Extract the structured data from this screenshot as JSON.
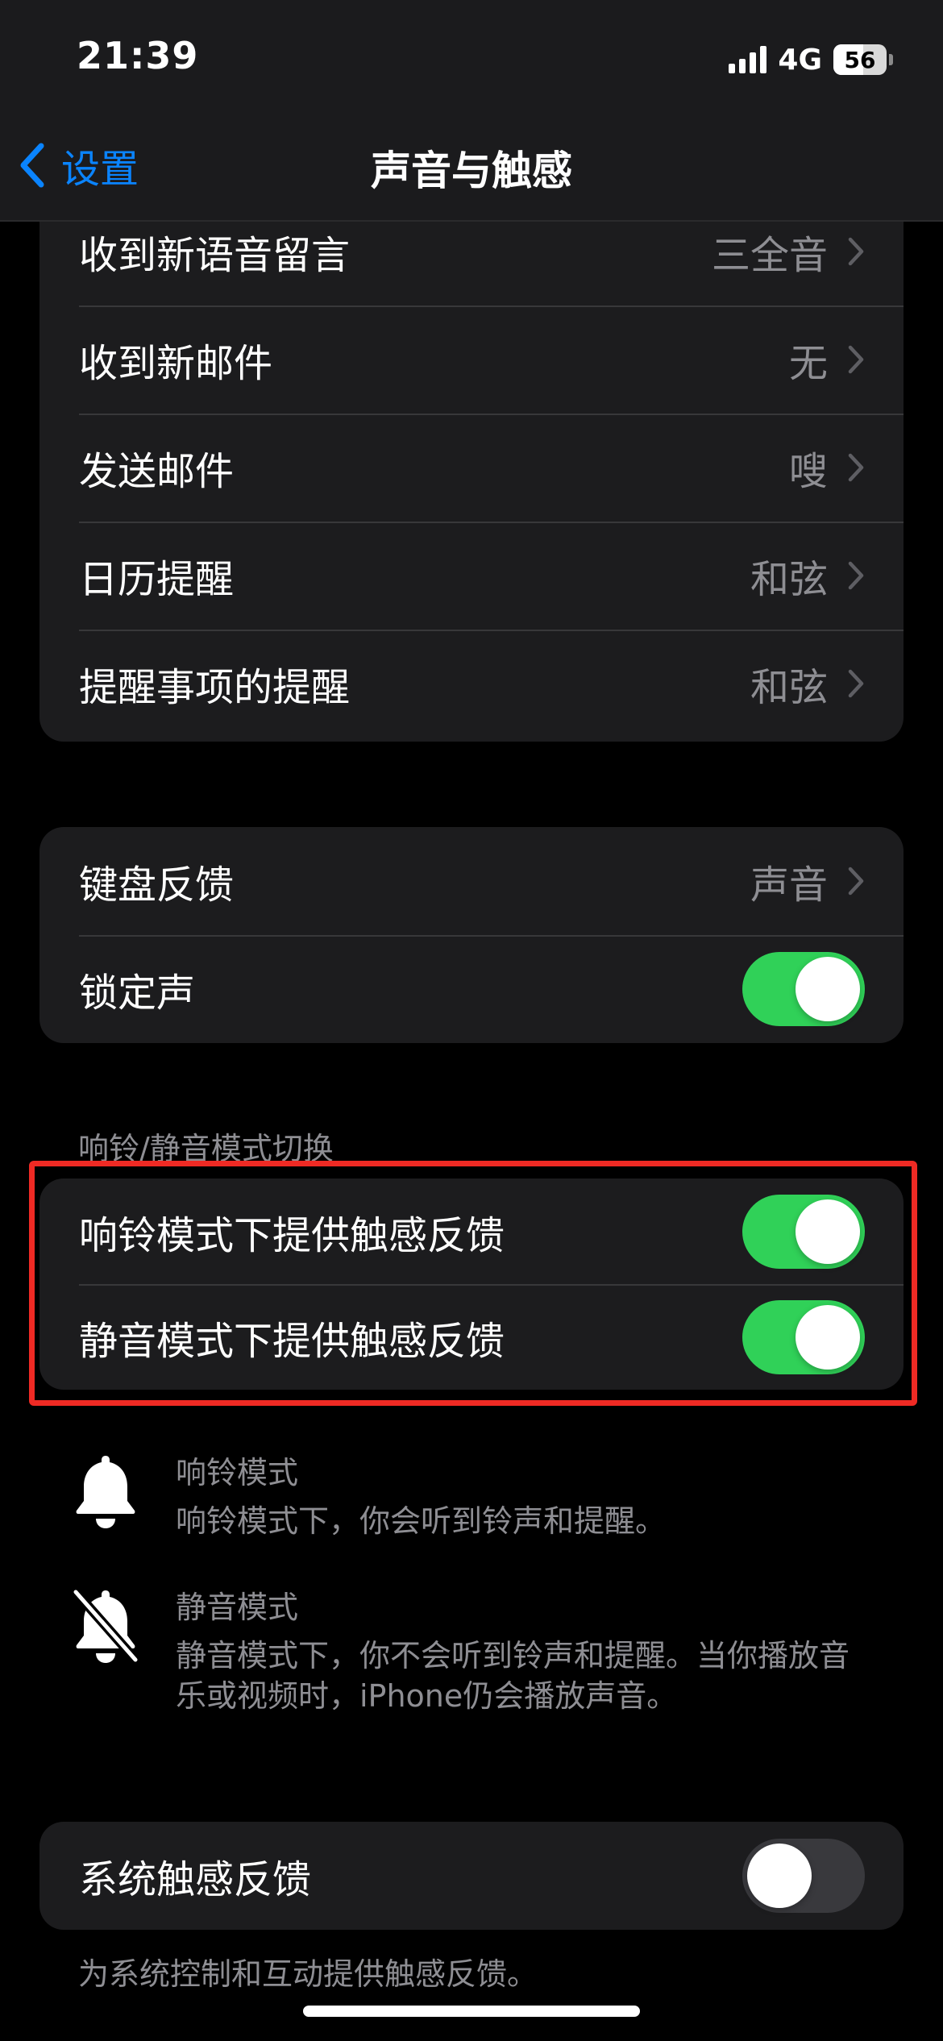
{
  "status_bar": {
    "time": "21:39",
    "network": "4G",
    "battery": "56",
    "battery_level": 0.56
  },
  "nav": {
    "back_label": "设置",
    "title": "声音与触感"
  },
  "sound_rows": [
    {
      "label": "收到新语音留言",
      "value": "三全音"
    },
    {
      "label": "收到新邮件",
      "value": "无"
    },
    {
      "label": "发送邮件",
      "value": "嗖"
    },
    {
      "label": "日历提醒",
      "value": "和弦"
    },
    {
      "label": "提醒事项的提醒",
      "value": "和弦"
    }
  ],
  "feedback": {
    "keyboard_label": "键盘反馈",
    "keyboard_value": "声音",
    "lock_label": "锁定声",
    "lock_on": true
  },
  "ring_silent": {
    "header": "响铃/静音模式切换",
    "ring_haptic_label": "响铃模式下提供触感反馈",
    "ring_haptic_on": true,
    "silent_haptic_label": "静音模式下提供触感反馈",
    "silent_haptic_on": true
  },
  "modes": {
    "ring_title": "响铃模式",
    "ring_desc": "响铃模式下，你会听到铃声和提醒。",
    "silent_title": "静音模式",
    "silent_desc_line1": "静音模式下，你不会听到铃声和提醒。当你播放音",
    "silent_desc_line2": "乐或视频时，iPhone仍会播放声音。"
  },
  "system_haptics": {
    "label": "系统触感反馈",
    "on": false,
    "footer": "为系统控制和互动提供触感反馈。"
  },
  "colors": {
    "accent": "#0a84ff",
    "toggle_on": "#30d158",
    "highlight": "#ef2a24",
    "cell_bg": "#1c1c1e"
  }
}
